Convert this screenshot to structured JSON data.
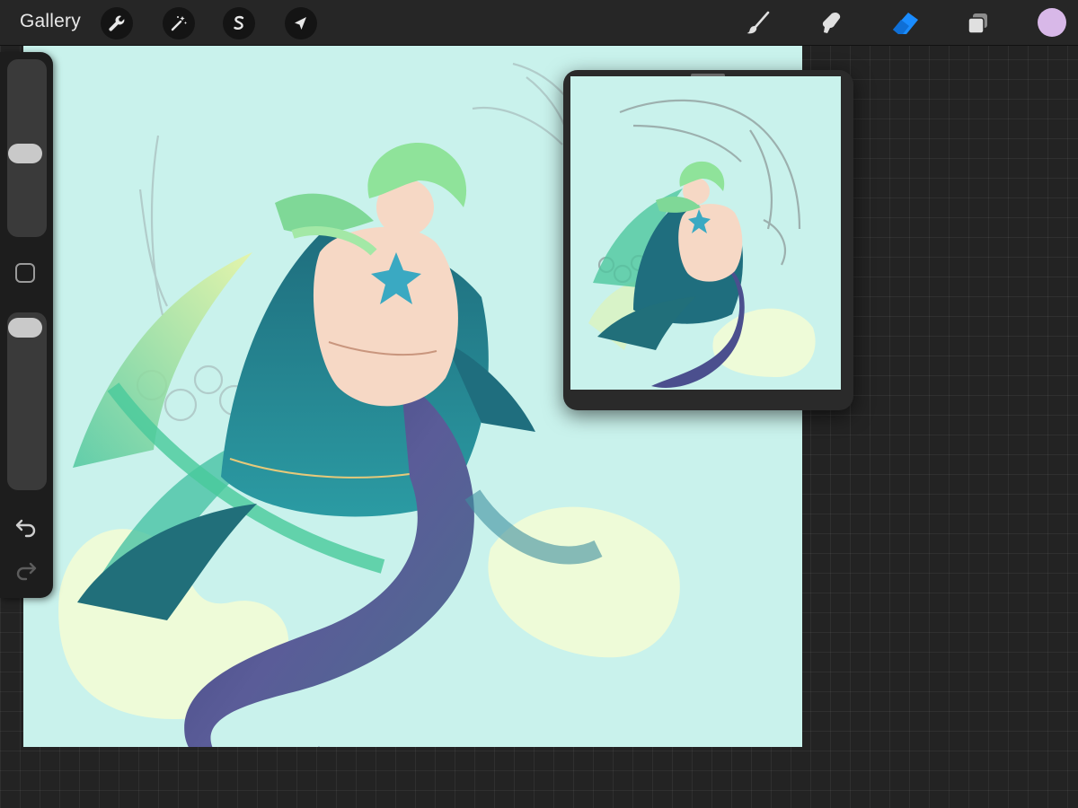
{
  "toolbar": {
    "gallery_label": "Gallery",
    "left_tools": [
      "wrench-icon",
      "magic-wand-icon",
      "selection-s-icon",
      "transform-arrow-icon"
    ],
    "right_tools": [
      "brush-icon",
      "smudge-icon",
      "eraser-icon",
      "layers-icon"
    ],
    "active_tool": "eraser",
    "current_color": "#d8b8e8"
  },
  "sidebar": {
    "brush_size_level": 0.5,
    "opacity_level": 0.05,
    "tools": [
      "modify-square-icon",
      "undo-icon",
      "redo-icon"
    ]
  },
  "canvas": {
    "background_color": "#c9f2ec"
  },
  "reference": {
    "background_color": "#c9f2ec"
  },
  "colors": {
    "accent": "#1a8cff",
    "interface": "#262626",
    "panel": "#1d1d1d"
  }
}
